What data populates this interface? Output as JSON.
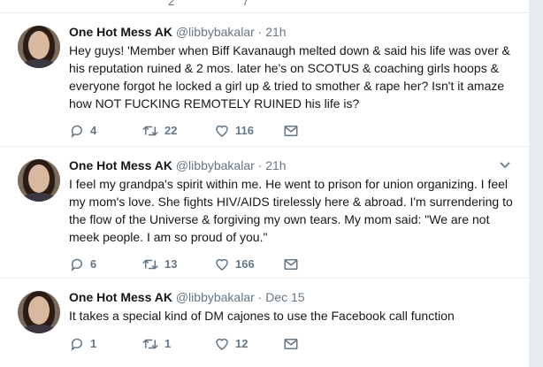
{
  "top_strip": {
    "retweets": "2",
    "likes": "7"
  },
  "tweets": [
    {
      "name": "One Hot Mess AK",
      "handle": "@libbybakalar",
      "separator": "·",
      "time": "21h",
      "text": "Hey guys! 'Member when Biff Kavanaugh melted down & said his life was over & his reputation ruined & 2 mos. later he's on SCOTUS & coaching girls hoops & everyone forgot he locked a girl up & tried to smother & rape her? Isn't it amaze how NOT FUCKING REMOTELY RUINED his life is?",
      "replies": "4",
      "retweets": "22",
      "likes": "116"
    },
    {
      "name": "One Hot Mess AK",
      "handle": "@libbybakalar",
      "separator": "·",
      "time": "21h",
      "text": "I feel my grandpa's spirit within me. He went to prison for union organizing. I feel my mom's love. She fights HIV/AIDS tirelessly here & abroad. I'm surrendering to the flow of the Universe & forgiving my own tears. My mom said: \"We are not meek people. I am so proud of you.\"",
      "replies": "6",
      "retweets": "13",
      "likes": "166"
    },
    {
      "name": "One Hot Mess AK",
      "handle": "@libbybakalar",
      "separator": "·",
      "time": "Dec 15",
      "text": "It takes a special kind of DM cajones to use the Facebook call function",
      "replies": "1",
      "retweets": "1",
      "likes": "12"
    }
  ]
}
